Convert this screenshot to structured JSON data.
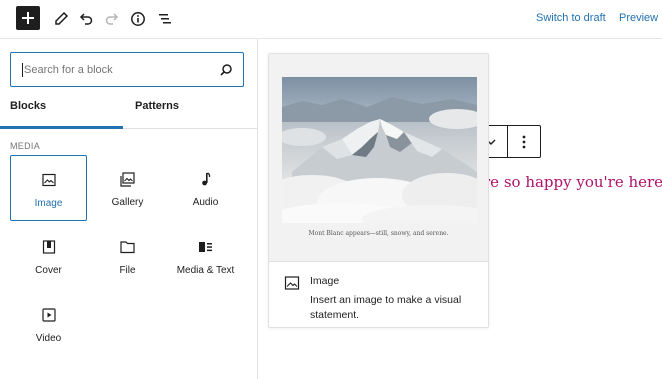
{
  "toolbar": {
    "switch_to_draft": "Switch to draft",
    "preview": "Preview"
  },
  "inserter": {
    "search_placeholder": "Search for a block",
    "tabs": [
      {
        "label": "Blocks",
        "active": true
      },
      {
        "label": "Patterns",
        "active": false
      }
    ],
    "section_label": "MEDIA",
    "blocks": [
      {
        "label": "Image",
        "icon": "image-icon",
        "selected": true
      },
      {
        "label": "Gallery",
        "icon": "gallery-icon"
      },
      {
        "label": "Audio",
        "icon": "audio-icon"
      },
      {
        "label": "Cover",
        "icon": "cover-icon"
      },
      {
        "label": "File",
        "icon": "file-icon"
      },
      {
        "label": "Media & Text",
        "icon": "media-text-icon"
      },
      {
        "label": "Video",
        "icon": "video-icon"
      }
    ]
  },
  "preview": {
    "caption": "Mont Blanc appears—still, snowy, and serene.",
    "title": "Image",
    "description": "Insert an image to make a visual statement."
  },
  "canvas": {
    "partial_text": "e're so happy you're here"
  },
  "colors": {
    "accent": "#2271b1",
    "canvas_text": "#b0126b",
    "dark": "#1e1e1e"
  }
}
